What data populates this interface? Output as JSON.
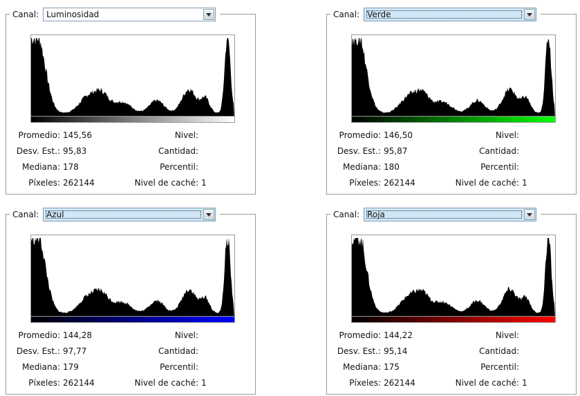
{
  "labels": {
    "channel": "Canal:",
    "mean": "Promedio:",
    "std": "Desv. Est.:",
    "median": "Mediana:",
    "pixels": "Píxeles:",
    "level": "Nivel:",
    "count": "Cantidad:",
    "percentile": "Percentil:",
    "cache_level": "Nivel de caché:"
  },
  "panels": [
    {
      "channel": "Luminosidad",
      "selected": false,
      "mean": "145,56",
      "std": "95,83",
      "median": "178",
      "pixels": "262144",
      "cache_level": "1",
      "gradient_end_color": "#ffffff"
    },
    {
      "channel": "Verde",
      "selected": true,
      "mean": "146,50",
      "std": "95,87",
      "median": "180",
      "pixels": "262144",
      "cache_level": "1",
      "gradient_end_color": "#00ff00"
    },
    {
      "channel": "Azul",
      "selected": true,
      "mean": "144,28",
      "std": "97,77",
      "median": "179",
      "pixels": "262144",
      "cache_level": "1",
      "gradient_end_color": "#0000ff"
    },
    {
      "channel": "Roja",
      "selected": true,
      "mean": "144,22",
      "std": "95,14",
      "median": "175",
      "pixels": "262144",
      "cache_level": "1",
      "gradient_end_color": "#ff0000"
    }
  ]
}
